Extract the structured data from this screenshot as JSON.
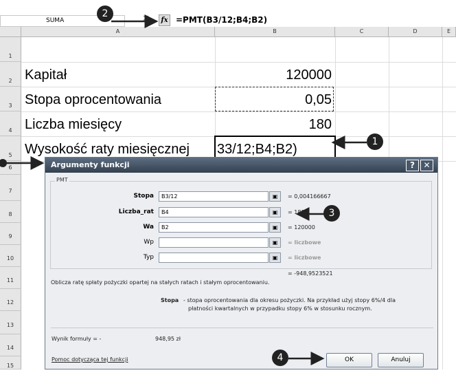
{
  "formula_bar": {
    "name_box": "SUMA",
    "cancel_symbol": "✕",
    "fx_label": "fx",
    "formula": "=PMT(B3/12;B4;B2)"
  },
  "columns": [
    "A",
    "B",
    "C",
    "D",
    "E"
  ],
  "rows": [
    "1",
    "2",
    "3",
    "4",
    "5",
    "6",
    "7",
    "8",
    "9",
    "10",
    "11",
    "12",
    "13",
    "14",
    "15"
  ],
  "cells": [
    {
      "label": "Kapitał",
      "value": "120000"
    },
    {
      "label": "Stopa oprocentowania",
      "value": "0,05"
    },
    {
      "label": "Liczba miesięcy",
      "value": "180"
    },
    {
      "label": "Wysokość raty miesięcznej",
      "value": "33/12;B4;B2)"
    }
  ],
  "dialog": {
    "title": "Argumenty funkcji",
    "help_button": "?",
    "close_button": "✕",
    "function_name": "PMT",
    "args": [
      {
        "label": "Stopa",
        "value": "B3/12",
        "result": "= 0,004166667",
        "bold": true
      },
      {
        "label": "Liczba_rat",
        "value": "B4",
        "result": "= 180",
        "bold": true
      },
      {
        "label": "Wa",
        "value": "B2",
        "result": "= 120000",
        "bold": true
      },
      {
        "label": "Wp",
        "value": "",
        "result": "= liczbowe",
        "bold": false
      },
      {
        "label": "Typ",
        "value": "",
        "result": "= liczbowe",
        "bold": false
      }
    ],
    "function_result": "= -948,9523521",
    "description": "Oblicza ratę spłaty pożyczki opartej na stałych ratach i stałym oprocentowaniu.",
    "arg_help_name": "Stopa",
    "arg_help_text_1": "- stopa oprocentowania dla okresu pożyczki. Na przykład użyj stopy 6%/4 dla",
    "arg_help_text_2": "płatności kwartalnych w przypadku stopy 6% w stosunku rocznym.",
    "formula_result_label": "Wynik formuły =  -",
    "formula_result_value": "948,95 zł",
    "help_link": "Pomoc dotycząca tej funkcji",
    "ok": "OK",
    "cancel": "Anuluj"
  },
  "callouts": [
    "1",
    "2",
    "3",
    "4"
  ]
}
